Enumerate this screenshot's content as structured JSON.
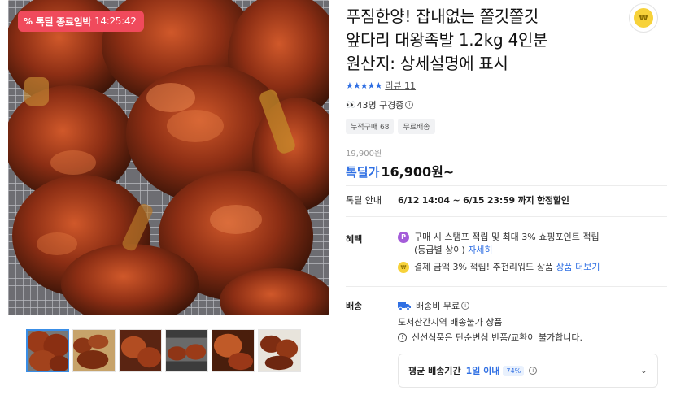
{
  "product": {
    "title_line1": "푸짐한양! 잡내없는 쫄깃쫄깃",
    "title_line2": "앞다리 대왕족발 1.2kg 4인분",
    "title_line3": "원산지: 상세설명에 표시",
    "rating_stars": "★★★★★",
    "review_label": "리뷰 11",
    "viewers_text": "43명 구경중",
    "chips": [
      "누적구매 68",
      "무료배송"
    ],
    "original_price": "19,900원",
    "sale_label": "톡딜가",
    "sale_price": "16,900원~"
  },
  "deal_badge": {
    "icon": "%",
    "label": "톡딜 종료임박",
    "timer": "14:25:42"
  },
  "deal_info": {
    "label": "톡딜 안내",
    "value": "6/12 14:04 ~ 6/15 23:59 까지 한정할인"
  },
  "benefits": {
    "label": "혜택",
    "item1_text": "구매 시 스탬프 적립 및 최대 3% 쇼핑포인트 적립",
    "item1_text2": "(등급별 상이)",
    "item1_link": "자세히",
    "item2_text": "결제 금액 3% 적립! 추천리워드 상품",
    "item2_link": "상품 더보기"
  },
  "shipping": {
    "label": "배송",
    "fee_text": "배송비 무료",
    "region_text": "도서산간지역 배송불가 상품",
    "note_text": "신선식품은 단순변심 반품/교환이 불가합니다.",
    "avg_label": "평균 배송기간",
    "avg_value": "1일 이내",
    "avg_pill": "74%"
  },
  "icons": {
    "share": "coin-share-icon",
    "chevron": "chevron-down-icon"
  },
  "colors": {
    "accent_blue": "#2f6fe3",
    "badge_red": "#f04a5c",
    "point_purple": "#a45cd9",
    "coin_yellow": "#f7d23a"
  }
}
